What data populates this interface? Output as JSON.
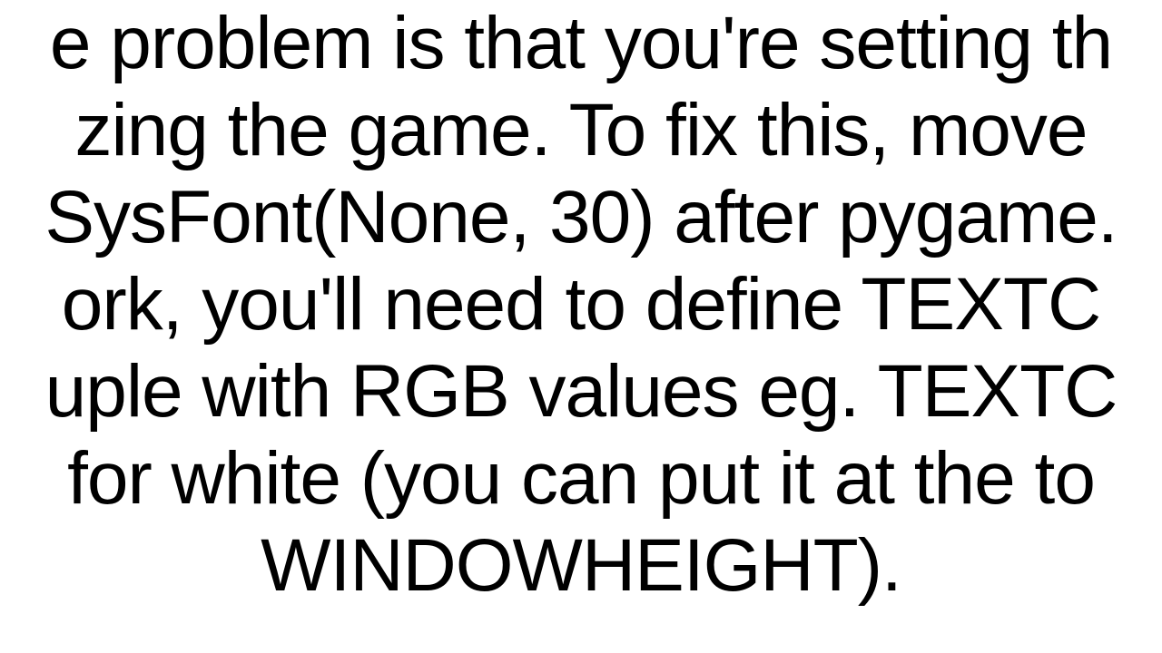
{
  "document": {
    "text": "e problem is that you're setting th\nzing the game. To fix this, move \nSysFont(None, 30) after pygame.\nork, you'll need to define TEXTC\nuple with RGB values eg. TEXTC\n for white (you can put it at the to\nWINDOWHEIGHT)."
  }
}
